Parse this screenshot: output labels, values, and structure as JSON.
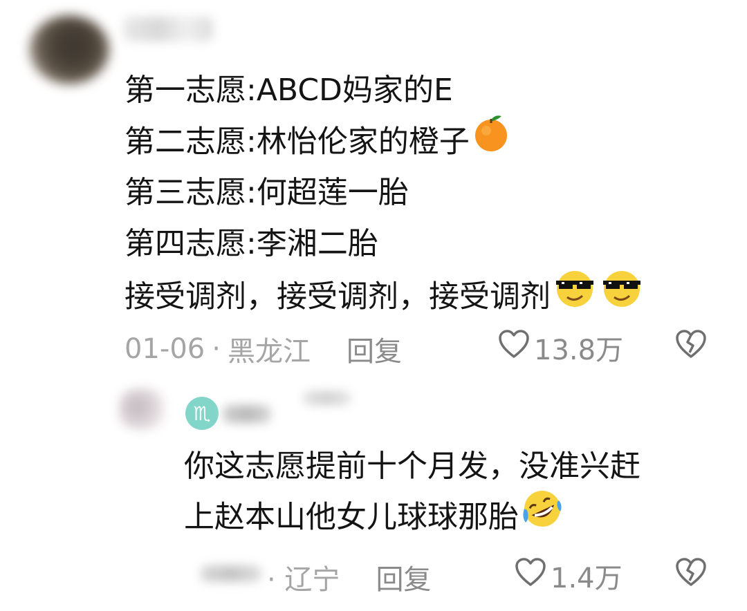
{
  "comment1": {
    "lines": [
      "第一志愿:ABCD妈家的E",
      "第二志愿:林怡伦家的橙子",
      "第三志愿:何超莲一胎",
      "第四志愿:李湘二胎",
      "接受调剂，接受调剂，接受调剂"
    ],
    "date": "01-06",
    "separator": "·",
    "location": "黑龙江",
    "reply_label": "回复",
    "like_count": "13.8万"
  },
  "comment2": {
    "zodiac_glyph": "♏",
    "lines": [
      "你这志愿提前十个月发，没准兴赶",
      "上赵本山他女儿球球那胎"
    ],
    "location": "· 辽宁",
    "reply_label": "回复",
    "like_count": "1.4万"
  },
  "icons": {
    "orange": "orange-emoji",
    "cool": "sunglasses-emoji",
    "laugh": "rofl-emoji",
    "like": "heart-outline-icon",
    "dislike": "broken-heart-icon"
  },
  "colors": {
    "text": "#141414",
    "meta": "#a5a5a5",
    "icon": "#8a8a8a",
    "zodiac_badge": "#82d6c9"
  }
}
